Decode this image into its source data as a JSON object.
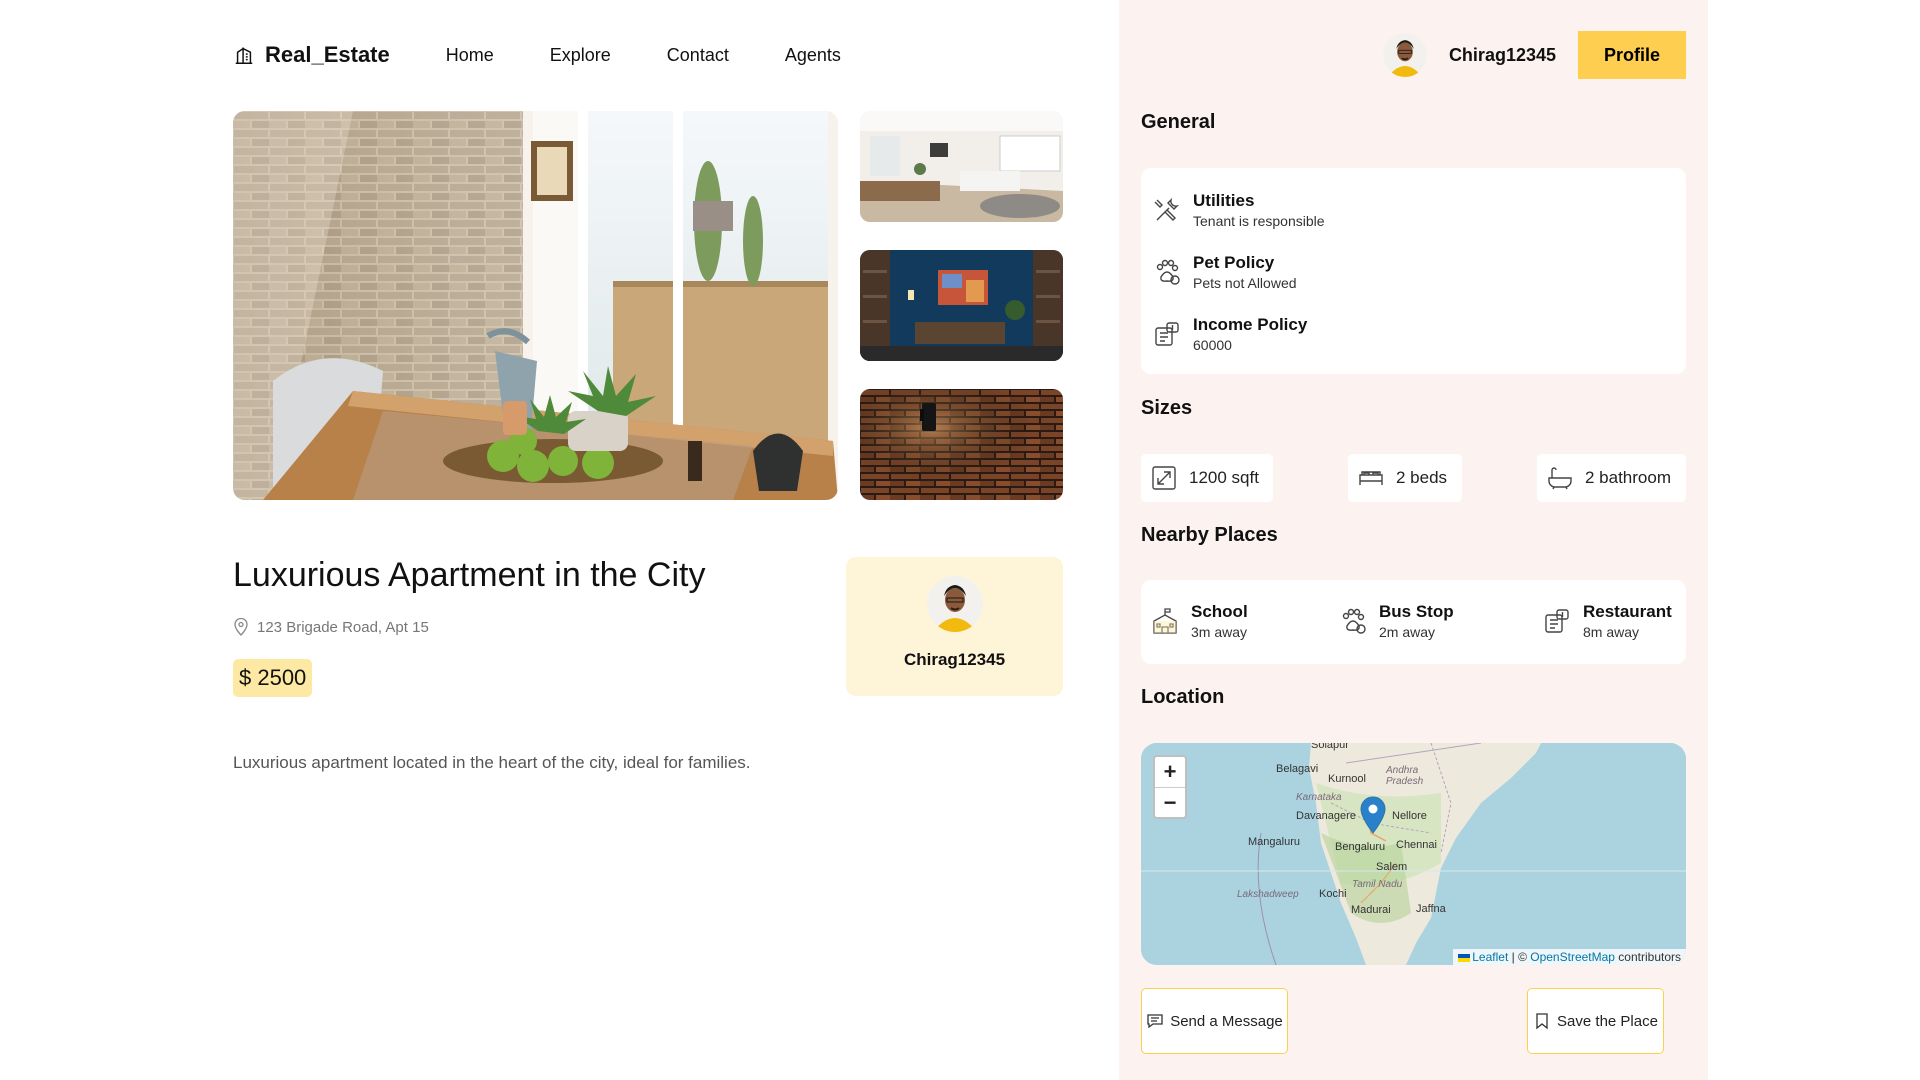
{
  "nav": {
    "logo_text": "Real_Estate",
    "links": [
      "Home",
      "Explore",
      "Contact",
      "Agents"
    ]
  },
  "listing": {
    "title": "Luxurious Apartment in the City",
    "address": "123 Brigade Road, Apt 15",
    "price": "$ 2500",
    "description": "Luxurious apartment located in the heart of the city, ideal for families.",
    "owner_name": "Chirag12345"
  },
  "header": {
    "username": "Chirag12345",
    "profile_label": "Profile"
  },
  "general": {
    "title": "General",
    "items": [
      {
        "title": "Utilities",
        "sub": "Tenant is responsible",
        "icon": "utilities-icon"
      },
      {
        "title": "Pet Policy",
        "sub": "Pets not Allowed",
        "icon": "pet-icon"
      },
      {
        "title": "Income Policy",
        "sub": "60000",
        "icon": "income-icon"
      }
    ]
  },
  "sizes": {
    "title": "Sizes",
    "area": "1200 sqft",
    "beds": "2 beds",
    "bathrooms": "2 bathroom"
  },
  "nearby": {
    "title": "Nearby Places",
    "items": [
      {
        "title": "School",
        "sub": "3m away",
        "icon": "school-icon"
      },
      {
        "title": "Bus Stop",
        "sub": "2m away",
        "icon": "bus-icon"
      },
      {
        "title": "Restaurant",
        "sub": "8m away",
        "icon": "restaurant-icon"
      }
    ]
  },
  "location": {
    "title": "Location",
    "zoom_in": "+",
    "zoom_out": "−",
    "attribution_leaflet": "Leaflet",
    "attribution_sep": " | © ",
    "attribution_osm": "OpenStreetMap",
    "attribution_rest": " contributors",
    "places": {
      "belagavi": "Belagavi",
      "kurnool": "Kurnool",
      "andhra": "Andhra Pradesh",
      "karnataka": "Karnataka",
      "davanagere": "Davanagere",
      "nellore": "Nellore",
      "mangaluru": "Mangaluru",
      "bengaluru": "Bengaluru",
      "chennai": "Chennai",
      "salem": "Salem",
      "lakshadweep": "Lakshadweep",
      "kochi": "Kochi",
      "tamilnadu": "Tamil Nadu",
      "madurai": "Madurai",
      "jaffna": "Jaffna",
      "solapur": "Solapur"
    }
  },
  "actions": {
    "send_message": "Send a Message",
    "save_place": "Save the Place"
  },
  "colors": {
    "accent": "#fece51",
    "panel_bg": "#fcf3f1",
    "price_bg": "#fde9a3",
    "owner_card_bg": "#fef5d9"
  }
}
